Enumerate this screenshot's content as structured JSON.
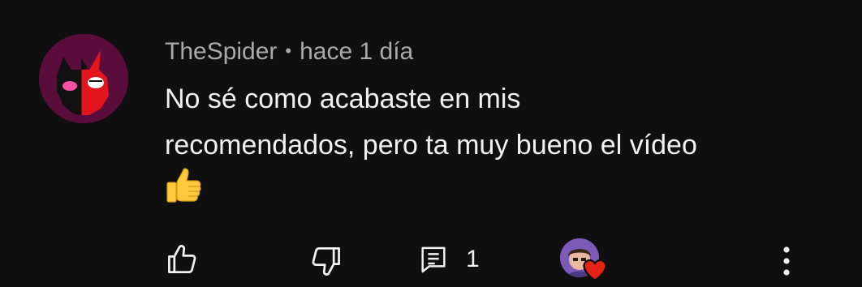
{
  "comment": {
    "author": "TheSpider",
    "separator": "•",
    "timestamp": "hace 1 día",
    "text_line_1": "No sé como acabaste en mis",
    "text_line_2": "recomendados, pero ta muy bueno el vídeo",
    "emoji": "👍",
    "avatar_icon": "devil-mask-avatar"
  },
  "actions": {
    "like_icon": "thumbs-up-icon",
    "dislike_icon": "thumbs-down-icon",
    "reply_icon": "comment-icon",
    "reply_count": "1",
    "creator_heart_icon": "heart-icon",
    "more_icon": "more-vert-icon"
  },
  "colors": {
    "background": "#0f0f0f",
    "text_primary": "#f1f1f1",
    "text_secondary": "#aaaaaa",
    "heart": "#e62117",
    "avatar_bg": "#5a0d3a"
  }
}
